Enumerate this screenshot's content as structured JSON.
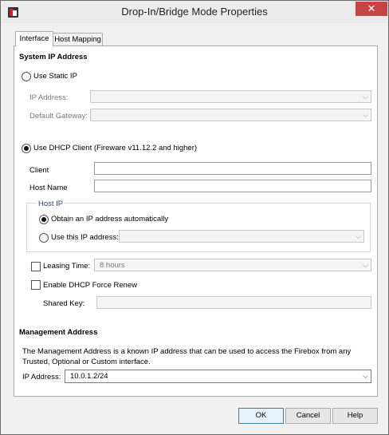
{
  "window": {
    "title": "Drop-In/Bridge Mode Properties",
    "close_glyph": "✕"
  },
  "tabs": [
    {
      "label": "Interface"
    },
    {
      "label": "Host Mapping"
    }
  ],
  "system_ip": {
    "title": "System IP Address",
    "static_label": "Use Static IP",
    "ip_address_label": "IP Address:",
    "default_gateway_label": "Default Gateway:",
    "dhcp_label": "Use DHCP Client (Fireware v11.12.2 and higher)",
    "client_label": "Client",
    "client_value": "",
    "host_name_label": "Host Name",
    "host_name_value": "",
    "host_ip": {
      "title": "Host IP",
      "obtain_label": "Obtain an IP address automatically",
      "use_this_label": "Use this IP address:"
    },
    "leasing_time_label": "Leasing Time:",
    "leasing_time_value": "8 hours",
    "force_renew_label": "Enable DHCP Force Renew",
    "shared_key_label": "Shared Key:"
  },
  "management": {
    "title": "Management Address",
    "description_line1": "The Management Address is a known IP address that can be used to access the Firebox from any",
    "description_line2": "Trusted, Optional or Custom interface.",
    "ip_label": "IP Address:",
    "ip_value": "10.0.1.2/24"
  },
  "buttons": {
    "ok": "OK",
    "cancel": "Cancel",
    "help": "Help"
  },
  "chevron_glyph": "⌵"
}
